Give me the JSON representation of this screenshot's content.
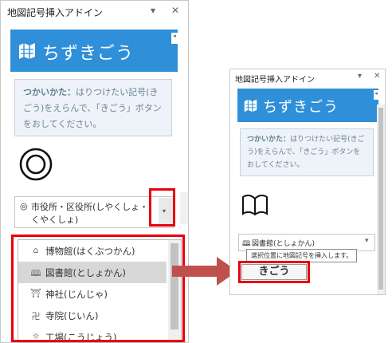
{
  "app": {
    "pane_title": "地図記号挿入アドイン",
    "brand": "ちずきごう",
    "collapse_glyph": "◂"
  },
  "window_controls": {
    "dropdown_glyph": "▾",
    "close_glyph": "✕"
  },
  "help": {
    "lead": "つかいかた：",
    "body": "はりつけたい記号(きごう)をえらんで、「きごう」ボタンをおしてください。"
  },
  "left": {
    "selected_symbol_icon": "◎",
    "select_value": "市役所・区役所(しやくしょ・くやくしょ)",
    "list_items": [
      {
        "icon": "博物館-icon",
        "glyph": "⌂",
        "label": "博物館(はくぶつかん)",
        "selected": false
      },
      {
        "icon": "図書館-icon",
        "glyph": "🕮",
        "label": "図書館(としょかん)",
        "selected": true
      },
      {
        "icon": "神社-icon",
        "glyph": "⛩",
        "label": "神社(じんじゃ)",
        "selected": false
      },
      {
        "icon": "寺院-icon",
        "glyph": "卍",
        "label": "寺院(じいん)",
        "selected": false
      },
      {
        "icon": "工場-icon",
        "glyph": "☼",
        "label": "工場(こうじょう)",
        "selected": false
      }
    ]
  },
  "right": {
    "select_value": "図書館(としょかん)",
    "select_glyph": "🕮",
    "tooltip": "選択位置に地図記号を挿入します。",
    "insert_button": "きごう"
  },
  "colors": {
    "accent": "#2f8fd8",
    "highlight": "#e8000b",
    "arrow": "#c0504d"
  }
}
